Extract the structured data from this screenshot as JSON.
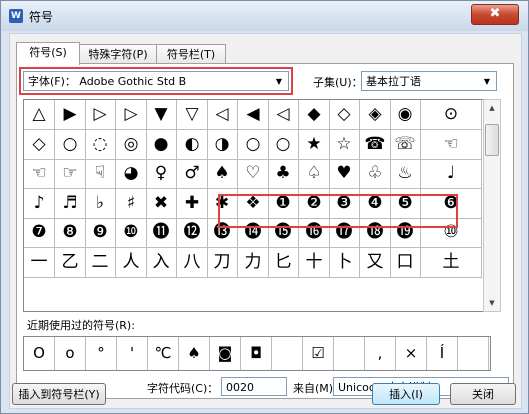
{
  "window": {
    "title": "符号",
    "close_label": "✖"
  },
  "tabs": [
    {
      "label": "符号(S)"
    },
    {
      "label": "特殊字符(P)"
    },
    {
      "label": "符号栏(T)"
    }
  ],
  "font": {
    "label": "字体(F)：",
    "value": "Adobe Gothic Std B"
  },
  "subset": {
    "label": "子集(U)：",
    "value": "基本拉丁语"
  },
  "grid_rows": [
    [
      "△",
      "▶",
      "▷",
      "▷",
      "▼",
      "▽",
      "◁",
      "◀",
      "◁",
      "◆",
      "◇",
      "◈",
      "◉"
    ],
    [
      "◇",
      "○",
      "◌",
      "◎",
      "●",
      "◐",
      "◑",
      "○",
      "○",
      "★",
      "☆",
      "☎",
      "☏"
    ],
    [
      "☜",
      "☞",
      "☟",
      "◕",
      "♀",
      "♂",
      "♠",
      "♡",
      "♣",
      "♤",
      "♥",
      "♧",
      "♨"
    ],
    [
      "♪",
      "♬",
      "♭",
      "♯",
      "✖",
      "✚",
      "✱",
      "❖",
      "❶",
      "❷",
      "❸",
      "❹",
      "❺"
    ],
    [
      "❼",
      "❽",
      "❾",
      "❿",
      "⓫",
      "⓬",
      "⓭",
      "⓮",
      "⓯",
      "⓰",
      "⓱",
      "⓲",
      "⓳"
    ],
    [
      "一",
      "乙",
      "二",
      "人",
      "入",
      "八",
      "刀",
      "力",
      "匕",
      "十",
      "卜",
      "又",
      "口"
    ]
  ],
  "grid_extra_col": [
    "⊙",
    "☜",
    "♩",
    "❻",
    "⑩",
    "土"
  ],
  "recent": {
    "label": "近期使用过的符号(R):",
    "items": [
      "O",
      "o",
      "°",
      "'",
      "℃",
      "♠",
      "◙",
      "◘",
      "",
      "☑",
      "",
      ",",
      "×",
      "Í",
      ""
    ]
  },
  "char_code": {
    "label": "字符代码(C)：",
    "value": "0020"
  },
  "from": {
    "label": "来自(M)",
    "value": "Unicode(十六进制)"
  },
  "buttons": {
    "insert_to_bar": "插入到符号栏(Y)",
    "insert": "插入(I)",
    "close": "关闭"
  }
}
